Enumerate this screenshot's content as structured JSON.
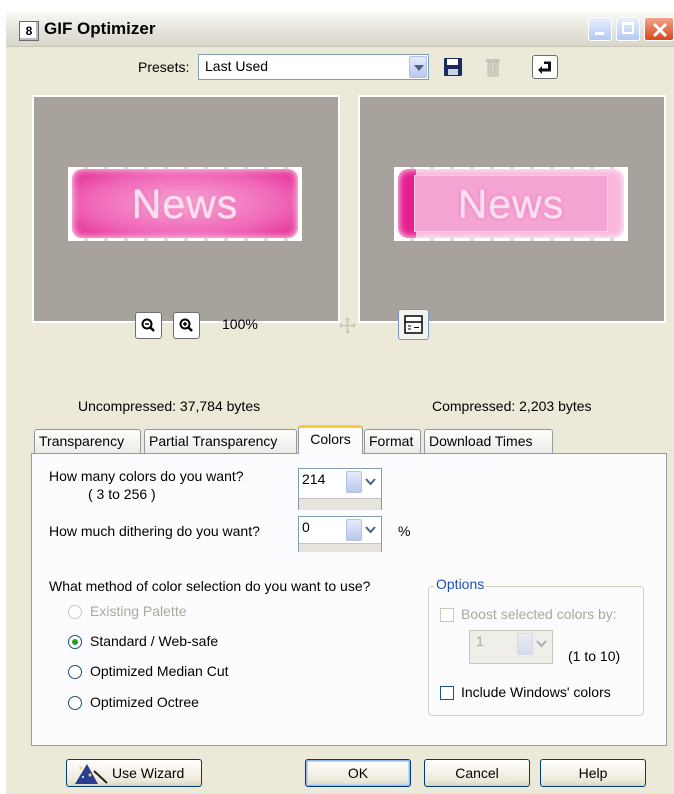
{
  "window": {
    "title": "GIF Optimizer",
    "icon_label": "8"
  },
  "presets": {
    "label": "Presets:",
    "value": "Last Used"
  },
  "previews": {
    "left_text": "News",
    "right_text": "News",
    "zoom": "100%",
    "uncompressed": "Uncompressed:  37,784 bytes",
    "compressed": "Compressed: 2,203 bytes"
  },
  "tabs": [
    {
      "label": "Transparency"
    },
    {
      "label": "Partial Transparency"
    },
    {
      "label": "Colors"
    },
    {
      "label": "Format"
    },
    {
      "label": "Download Times"
    }
  ],
  "active_tab": "Colors",
  "colors": {
    "count_question": "How many colors do you want?",
    "count_range": "( 3  to  256 )",
    "count_value": "214",
    "dither_question": "How much dithering do you want?",
    "dither_value": "0",
    "dither_unit": "%",
    "method_question": "What method of color selection do you want to use?",
    "methods": [
      {
        "label": "Existing Palette",
        "selected": false,
        "enabled": false
      },
      {
        "label": "Standard / Web-safe",
        "selected": true,
        "enabled": true
      },
      {
        "label": "Optimized Median Cut",
        "selected": false,
        "enabled": true
      },
      {
        "label": "Optimized Octree",
        "selected": false,
        "enabled": true
      }
    ]
  },
  "options": {
    "title": "Options",
    "boost_label": "Boost selected colors by:",
    "boost_value": "1",
    "boost_range": "(1 to 10)",
    "include_windows_label": "Include Windows' colors"
  },
  "buttons": {
    "wizard": "Use Wizard",
    "ok": "OK",
    "cancel": "Cancel",
    "help": "Help"
  },
  "theme": {
    "dialog_bg": "#ece9d8",
    "preview_bg": "#a7a29c",
    "accent_pink": "#e4248f",
    "group_title": "#1f4fb0"
  }
}
